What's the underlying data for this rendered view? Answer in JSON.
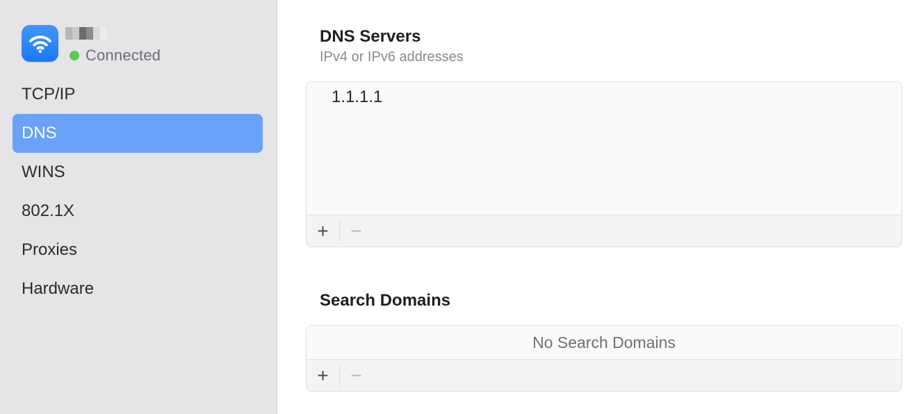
{
  "sidebar": {
    "network_status": "Connected",
    "items": [
      {
        "label": "TCP/IP",
        "selected": false
      },
      {
        "label": "DNS",
        "selected": true
      },
      {
        "label": "WINS",
        "selected": false
      },
      {
        "label": "802.1X",
        "selected": false
      },
      {
        "label": "Proxies",
        "selected": false
      },
      {
        "label": "Hardware",
        "selected": false
      }
    ]
  },
  "dns": {
    "title": "DNS Servers",
    "subtitle": "IPv4 or IPv6 addresses",
    "servers": [
      "1.1.1.1"
    ],
    "add_icon": "+",
    "remove_icon": "−"
  },
  "search_domains": {
    "title": "Search Domains",
    "empty_text": "No Search Domains",
    "add_icon": "+",
    "remove_icon": "−"
  },
  "colors": {
    "accent_selected": "#6aa1f9",
    "wifi_tile": "#1b78f2",
    "status_connected": "#5ec84f"
  }
}
